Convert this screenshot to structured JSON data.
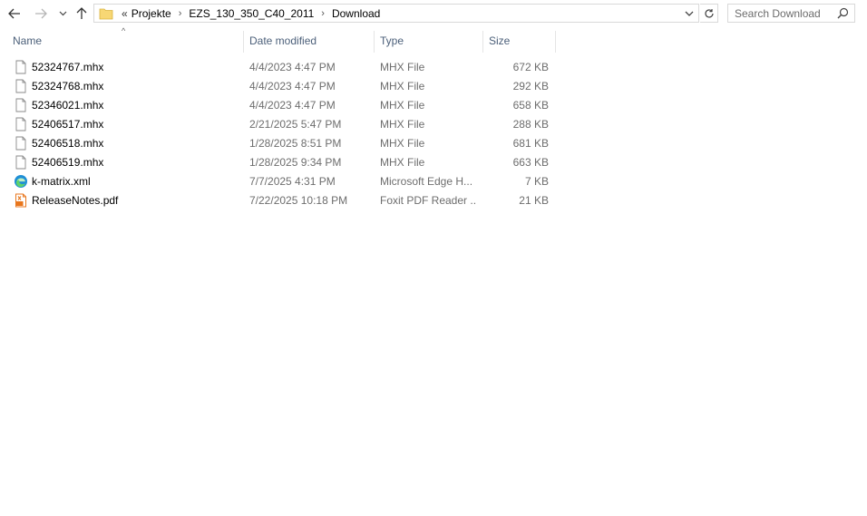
{
  "address": {
    "overflow": "«",
    "crumbs": [
      "Projekte",
      "EZS_130_350_C40_2011",
      "Download"
    ]
  },
  "search": {
    "placeholder": "Search Download"
  },
  "columns": {
    "name": "Name",
    "date": "Date modified",
    "type": "Type",
    "size": "Size"
  },
  "files": [
    {
      "name": "52324767.mhx",
      "date": "4/4/2023 4:47 PM",
      "type": "MHX File",
      "size": "672 KB",
      "icon": "file-icon"
    },
    {
      "name": "52324768.mhx",
      "date": "4/4/2023 4:47 PM",
      "type": "MHX File",
      "size": "292 KB",
      "icon": "file-icon"
    },
    {
      "name": "52346021.mhx",
      "date": "4/4/2023 4:47 PM",
      "type": "MHX File",
      "size": "658 KB",
      "icon": "file-icon"
    },
    {
      "name": "52406517.mhx",
      "date": "2/21/2025 5:47 PM",
      "type": "MHX File",
      "size": "288 KB",
      "icon": "file-icon"
    },
    {
      "name": "52406518.mhx",
      "date": "1/28/2025 8:51 PM",
      "type": "MHX File",
      "size": "681 KB",
      "icon": "file-icon"
    },
    {
      "name": "52406519.mhx",
      "date": "1/28/2025 9:34 PM",
      "type": "MHX File",
      "size": "663 KB",
      "icon": "file-icon"
    },
    {
      "name": "k-matrix.xml",
      "date": "7/7/2025 4:31 PM",
      "type": "Microsoft Edge H...",
      "size": "7 KB",
      "icon": "edge-icon"
    },
    {
      "name": "ReleaseNotes.pdf",
      "date": "7/22/2025 10:18 PM",
      "type": "Foxit PDF Reader ...",
      "size": "21 KB",
      "icon": "pdf-icon"
    }
  ],
  "colors": {
    "header_text": "#4c607a",
    "muted_text": "#6d6d6d",
    "folder": "#f7d774",
    "pdf": "#e8761c",
    "edge": "#1f8fd6"
  }
}
